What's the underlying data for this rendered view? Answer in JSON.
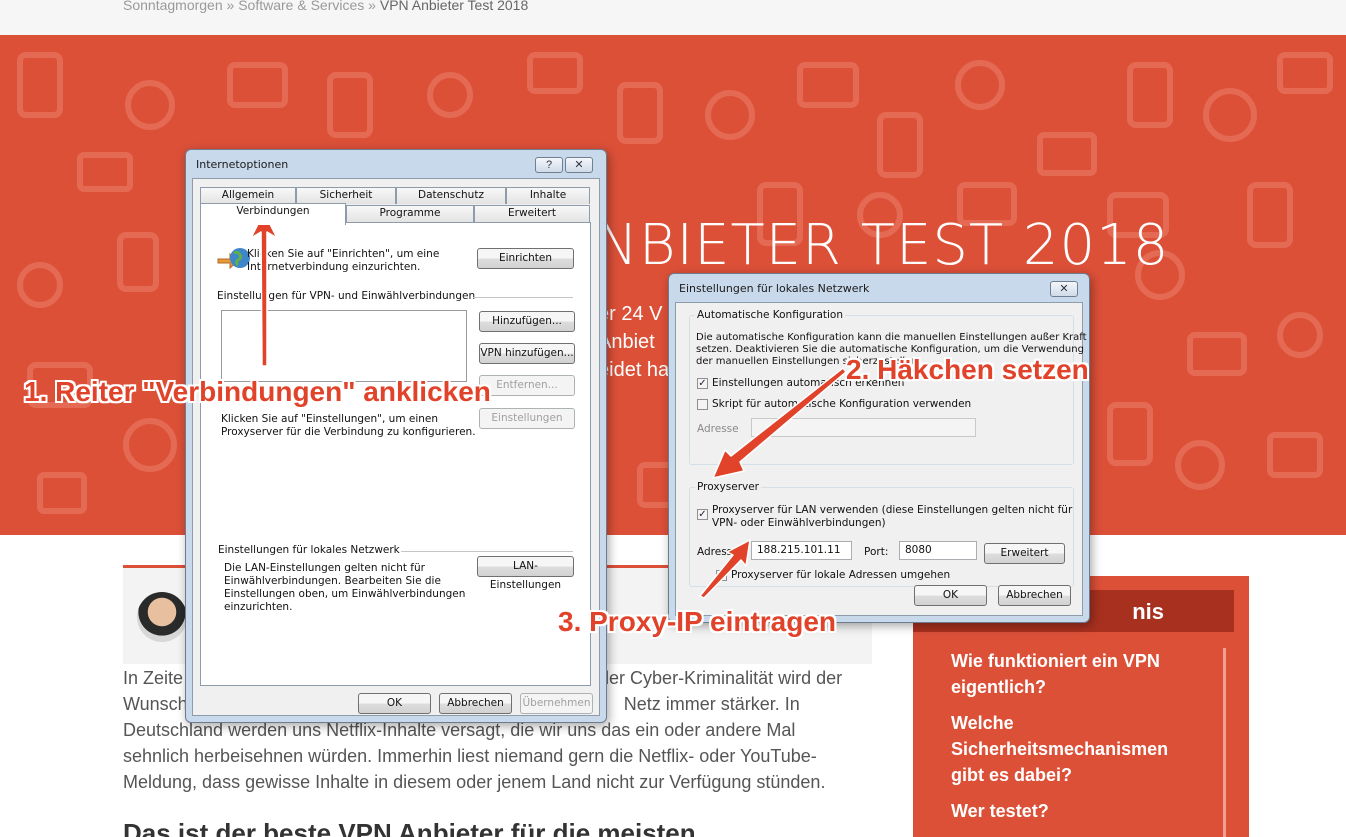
{
  "breadcrumb": {
    "home": "Sonntagmorgen",
    "sep1": "»",
    "category": "Software & Services",
    "sep2": "»",
    "current": "VPN Anbieter Test 2018"
  },
  "hero": {
    "title_visible": "NBIETER TEST 2018",
    "sub_line1": "er 24 V",
    "sub_line2": "Anbiet",
    "sub_line3": "eidet ha"
  },
  "article": {
    "para_lines": [
      "In Zeite",
      "der Cyber-Kriminalität wird der",
      "Wunsch",
      "Netz immer stärker. In",
      "Deutschland werden uns Netflix-Inhalte versagt, die wir uns das ein oder andere Mal",
      "sehnlich herbeisehnen würden. Immerhin liest niemand gern die Netflix- oder YouTube-",
      "Meldung, dass gewisse Inhalte in diesem oder jenem Land nicht zur Verfügung stünden."
    ],
    "heading_partial": "Das ist der beste VPN Anbieter für die meisten"
  },
  "toc": {
    "title_partial": "nis",
    "items": [
      "Wie funktioniert ein VPN eigentlich?",
      "Welche Sicherheitsmechanismen gibt es dabei?",
      "Wer testet?"
    ]
  },
  "internet_options": {
    "title": "Internetoptionen",
    "help_btn": "?",
    "close_btn": "✕",
    "tabs_row1": [
      "Allgemein",
      "Sicherheit",
      "Datenschutz",
      "Inhalte"
    ],
    "tabs_row2": [
      "Verbindungen",
      "Programme",
      "Erweitert"
    ],
    "setup_text_1": "Klicken Sie auf \"Einrichten\", um eine",
    "setup_text_2": "Internetverbindung einzurichten.",
    "setup_btn": "Einrichten",
    "vpn_section": "Einstellungen für VPN- und Einwählverbindungen",
    "add_btn": "Hinzufügen...",
    "add_vpn_btn": "VPN hinzufügen...",
    "remove_btn": "Entfernen...",
    "settings_btn": "Einstellungen",
    "proxy_text_1": "Klicken Sie auf \"Einstellungen\", um einen",
    "proxy_text_2": "Proxyserver für die Verbindung zu konfigurieren.",
    "lan_section": "Einstellungen für lokales Netzwerk",
    "lan_text": [
      "Die LAN-Einstellungen gelten nicht für",
      "Einwählverbindungen. Bearbeiten Sie die",
      "Einstellungen oben, um Einwählverbindungen",
      "einzurichten."
    ],
    "lan_btn": "LAN-Einstellungen",
    "ok_btn": "OK",
    "cancel_btn": "Abbrechen",
    "apply_btn": "Übernehmen"
  },
  "lan_dialog": {
    "title": "Einstellungen für lokales Netzwerk",
    "close_btn": "✕",
    "auto_group": "Automatische Konfiguration",
    "auto_text": [
      "Die automatische Konfiguration kann die manuellen Einstellungen außer Kraft",
      "setzen. Deaktivieren Sie die automatische Konfiguration, um die Verwendung",
      "der manuellen Einstellungen sicherzustellen."
    ],
    "auto_detect": "Einstellungen automatisch erkennen",
    "auto_script": "Skript für automatische Konfiguration verwenden",
    "address_label_dis": "Adresse",
    "proxy_group": "Proxyserver",
    "proxy_check_1": "Proxyserver für LAN verwenden (diese Einstellungen gelten nicht für",
    "proxy_check_2": "VPN- oder Einwählverbindungen)",
    "address_label": "Adresse:",
    "address_value": "188.215.101.11",
    "port_label": "Port:",
    "port_value": "8080",
    "advanced_btn": "Erweitert",
    "bypass": "Proxyserver für lokale Adressen umgehen",
    "ok_btn": "OK",
    "cancel_btn": "Abbrechen"
  },
  "annotations": {
    "step1": "1. Reiter \"Verbindungen\" anklicken",
    "step2": "2. Häkchen setzen",
    "step3": "3. Proxy-IP eintragen",
    "color": "#e0432a"
  }
}
